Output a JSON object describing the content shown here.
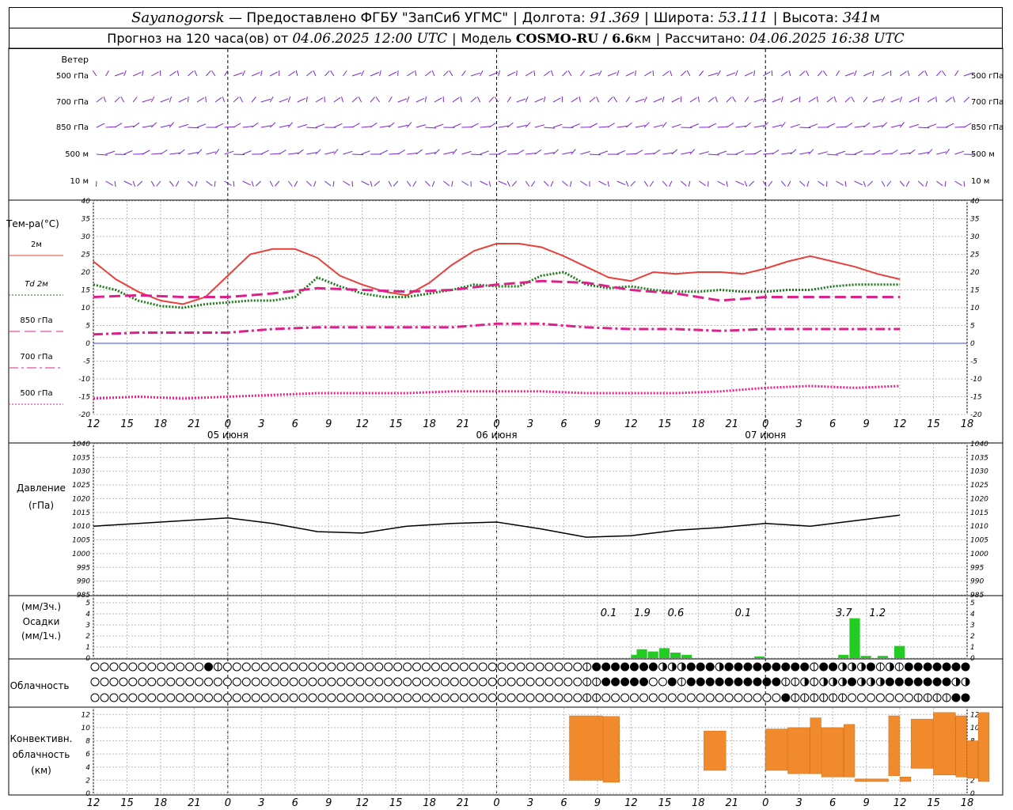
{
  "header": {
    "station": "Sayanogorsk",
    "dash": " — ",
    "provider": "Предоставлено ФГБУ \"ЗапСиб УГМС\"",
    "lon_label": "Долгота:",
    "lon": "91.369",
    "lat_label": "Широта:",
    "lat": "53.111",
    "alt_label": "Высота:",
    "alt": "341",
    "alt_unit": "м"
  },
  "subheader": {
    "forecast_prefix": "Прогноз на 120 часа(ов) от",
    "forecast_time": "04.06.2025 12:00 UTC",
    "model_label": "Модель",
    "model": "COSMO-RU / 6.6",
    "model_unit": "км",
    "calc_label": "Рассчитано:",
    "calc_time": "04.06.2025 16:38 UTC"
  },
  "chart_data": {
    "type": "line",
    "hours": [
      "12",
      "15",
      "18",
      "21",
      "0",
      "3",
      "6",
      "9",
      "12",
      "15",
      "18",
      "21",
      "0",
      "3",
      "6",
      "9",
      "12",
      "15",
      "18",
      "21",
      "0",
      "3",
      "6",
      "9",
      "12",
      "15",
      "18"
    ],
    "dates": [
      {
        "label": "05 июня",
        "hour_index": 12
      },
      {
        "label": "06 июня",
        "hour_index": 36
      },
      {
        "label": "07 июня",
        "hour_index": 60
      }
    ],
    "wind": {
      "title": "Ветер",
      "levels": [
        "500 гПа",
        "700 гПа",
        "850 гПа",
        "500 м",
        "10 м"
      ]
    },
    "temperature": {
      "title": "Тем-ра(°С)",
      "ylim": [
        -20,
        40
      ],
      "yticks": [
        40,
        35,
        30,
        25,
        20,
        15,
        10,
        5,
        0,
        -5,
        -10,
        -15,
        -20
      ],
      "series": [
        {
          "name": "2м",
          "color": "#e8403a",
          "style": "solid",
          "x": [
            0,
            2,
            4,
            6,
            8,
            10,
            12,
            14,
            16,
            18,
            20,
            22,
            24,
            26,
            28,
            30,
            32,
            34,
            36,
            38,
            40,
            42,
            44,
            46,
            48,
            50,
            52,
            54,
            56,
            58,
            60,
            62,
            64,
            66,
            68,
            70,
            72
          ],
          "y": [
            23,
            18,
            14.5,
            12,
            11,
            13,
            19,
            25,
            26.5,
            26.5,
            24,
            19,
            16.5,
            14.5,
            13.5,
            17,
            22,
            26,
            28,
            28,
            27,
            24.5,
            21.5,
            18.5,
            17.5,
            20,
            19.5,
            20,
            20,
            19.5,
            21,
            23,
            24.5,
            23,
            21.5,
            19.5,
            18
          ]
        },
        {
          "name": "Td 2м",
          "color": "#1a7a1a",
          "style": "dotted",
          "x": [
            0,
            2,
            4,
            6,
            8,
            10,
            12,
            14,
            16,
            18,
            20,
            22,
            24,
            26,
            28,
            30,
            32,
            34,
            36,
            38,
            40,
            42,
            44,
            46,
            48,
            50,
            52,
            54,
            56,
            58,
            60,
            62,
            64,
            66,
            68,
            70,
            72
          ],
          "y": [
            16.5,
            15,
            12,
            10.5,
            10,
            11,
            11.5,
            12,
            12,
            13,
            18.5,
            16,
            14,
            13,
            13,
            14,
            15,
            16.5,
            16,
            16,
            19,
            20,
            16.5,
            15.5,
            16,
            15,
            14.5,
            14.5,
            15,
            14.5,
            14.5,
            15,
            15,
            16,
            16.5,
            16.5,
            16.5
          ]
        },
        {
          "name": "850 гПа",
          "color": "#e0208a",
          "style": "longdash",
          "x": [
            0,
            4,
            8,
            12,
            16,
            20,
            24,
            28,
            32,
            36,
            40,
            44,
            48,
            52,
            56,
            60,
            64,
            68,
            72
          ],
          "y": [
            13,
            13.5,
            13,
            13,
            14,
            15.5,
            15,
            14.5,
            15,
            16.5,
            17.5,
            17,
            15,
            14,
            12,
            13,
            13,
            13,
            13
          ]
        },
        {
          "name": "700 гПа",
          "color": "#e0208a",
          "style": "dashdot",
          "x": [
            0,
            4,
            8,
            12,
            16,
            20,
            24,
            28,
            32,
            36,
            40,
            44,
            48,
            52,
            56,
            60,
            64,
            68,
            72
          ],
          "y": [
            2.5,
            3,
            3,
            3,
            4,
            4.5,
            4.5,
            4.5,
            4.5,
            5.5,
            5.5,
            4.5,
            4,
            4,
            3.5,
            4,
            4,
            4,
            4
          ]
        },
        {
          "name": "500 гПа",
          "color": "#e0208a",
          "style": "dotted",
          "x": [
            0,
            4,
            8,
            12,
            16,
            20,
            24,
            28,
            32,
            36,
            40,
            44,
            48,
            52,
            56,
            60,
            64,
            68,
            72
          ],
          "y": [
            -15.5,
            -15,
            -15.5,
            -15,
            -14.5,
            -14,
            -14,
            -14,
            -13.5,
            -13.5,
            -13.5,
            -14,
            -14,
            -14,
            -13.5,
            -12.5,
            -12,
            -12.5,
            -12
          ]
        }
      ]
    },
    "pressure": {
      "title": "Давление",
      "unit": "(гПа)",
      "ylim": [
        985,
        1040
      ],
      "yticks": [
        1040,
        1035,
        1030,
        1025,
        1020,
        1015,
        1010,
        1005,
        1000,
        995,
        990,
        985
      ],
      "x": [
        0,
        4,
        8,
        12,
        16,
        20,
        24,
        28,
        32,
        36,
        40,
        44,
        48,
        52,
        56,
        60,
        64,
        68,
        72
      ],
      "y": [
        1010,
        1011,
        1012,
        1013,
        1011,
        1008,
        1007.5,
        1010,
        1011,
        1011.5,
        1009,
        1006,
        1006.5,
        1008.5,
        1009.5,
        1011,
        1010,
        1012,
        1014
      ]
    },
    "precip": {
      "title_top": "(мм/3ч.)",
      "title": "Осадки",
      "title_bottom": "(мм/1ч.)",
      "ylim": [
        0,
        5
      ],
      "yticks": [
        5,
        4,
        3,
        2,
        1,
        0
      ],
      "labels": [
        {
          "text": "0.1",
          "hour_index": 46
        },
        {
          "text": "1.9",
          "hour_index": 49
        },
        {
          "text": "0.6",
          "hour_index": 52
        },
        {
          "text": "0.1",
          "hour_index": 58
        },
        {
          "text": "3.7",
          "hour_index": 67
        },
        {
          "text": "1.2",
          "hour_index": 70
        }
      ],
      "bars": [
        {
          "x": 48,
          "v": 0.3
        },
        {
          "x": 48.5,
          "v": 0.8
        },
        {
          "x": 49.5,
          "v": 0.6
        },
        {
          "x": 50.5,
          "v": 0.9
        },
        {
          "x": 51.5,
          "v": 0.5
        },
        {
          "x": 52.5,
          "v": 0.3
        },
        {
          "x": 59,
          "v": 0.15
        },
        {
          "x": 66.5,
          "v": 0.3
        },
        {
          "x": 67.5,
          "v": 3.6
        },
        {
          "x": 68.5,
          "v": 0.2
        },
        {
          "x": 70,
          "v": 0.2
        },
        {
          "x": 71.5,
          "v": 1.1
        }
      ]
    },
    "clouds": {
      "title": "Облачность",
      "rows": [
        "0000000000000000000000000000000000000000000000000000000000000000000042000000000000000000000000000000000000000000000000000000000000000000000000000000000000000000000000000000000000000000000000000000000000000000000000000000000000000000000000000000000000000000000000000000000000000000000000000000000000000000000000000000000000000000000000000000000000000000000000000000000000000000000000000000000000000000000000000000000000000000000000000000000000000000000000000000000000000000000000000000000000000000000000000000000000000000000000000000000000000000000000000000000000000000000000000000000000000000000000000000000000000000000000000000000000",
        "0000000000000000000000000000000000000000000000000000000000000000000000000000000000000000000000000000000000000000000000000000000000000000000000000000000000000000000000000000000000000000000000000000000000000000000000000000000000000000000000000000000000000000000000000000000000000000000000000000000000000000000000000000000000000000000000000000000000000000000000000000000000000000000000000000000000000000000000000000000000000000000000000000000000000000000000000000000000000000000000000000000000000000000000000000000000000000000000000000000000000000000000000000000000000000000000000000000000000000000000000000000000000000000000000000000000",
        "0000000000000000000000000000000000000000000000000000000000000000000000000000000000000000000000000000000000000000000000000000000000000000000000000000000000000000000000000000000000000000000000000000000000000000000000000000000000000000000000000000000000000000000000000000000000000000000000000000000000000000000000000000000000000000000000000000000000000000000000000000000000000000000000000000000000000000000000000000000000000000000000000000000000000000000000000000000000000000000000000000000000000000000000000000000000000000000000000000000000000000000000000000000000000000000000000000000000000000000000000000000000000000000000000000000000"
      ],
      "row_values": [
        "000000000000620000000000000000000000000000000000000024444444333444344444444424433342324444444",
        "000000000000000000000000000000000000000000000000000022444440042444444444422323334333444444433",
        "000000000000000000000000000000000000000000000000000022000000000000000000042222220000000222244"
      ]
    },
    "convective": {
      "title": [
        "Конвективн.",
        "облачность",
        "(км)"
      ],
      "ylim": [
        0,
        13
      ],
      "yticks": [
        12,
        10,
        8,
        6,
        4,
        2,
        0
      ],
      "bars": [
        {
          "x0": 42.5,
          "x1": 45.5,
          "b": 2,
          "t": 11.8
        },
        {
          "x0": 45.5,
          "x1": 47,
          "b": 1.7,
          "t": 11.7
        },
        {
          "x0": 54.5,
          "x1": 56.5,
          "b": 3.5,
          "t": 9.5
        },
        {
          "x0": 60,
          "x1": 62,
          "b": 3.5,
          "t": 9.8
        },
        {
          "x0": 62,
          "x1": 64,
          "b": 3,
          "t": 10
        },
        {
          "x0": 64,
          "x1": 65,
          "b": 3,
          "t": 11.5
        },
        {
          "x0": 65,
          "x1": 67,
          "b": 2.5,
          "t": 10
        },
        {
          "x0": 67,
          "x1": 68,
          "b": 2.5,
          "t": 10.5
        },
        {
          "x0": 68,
          "x1": 71,
          "b": 1.8,
          "t": 2.2
        },
        {
          "x0": 71,
          "x1": 72,
          "b": 2.7,
          "t": 11.8
        },
        {
          "x0": 72,
          "x1": 73,
          "b": 1.8,
          "t": 2.5
        },
        {
          "x0": 73,
          "x1": 75,
          "b": 3.8,
          "t": 11.3
        },
        {
          "x0": 75,
          "x1": 77,
          "b": 2.8,
          "t": 12.3
        },
        {
          "x0": 77,
          "x1": 78,
          "b": 2.5,
          "t": 11.8
        },
        {
          "x0": 78,
          "x1": 79,
          "b": 2.3,
          "t": 8
        },
        {
          "x0": 79,
          "x1": 80,
          "b": 1.8,
          "t": 12.3
        }
      ]
    }
  }
}
